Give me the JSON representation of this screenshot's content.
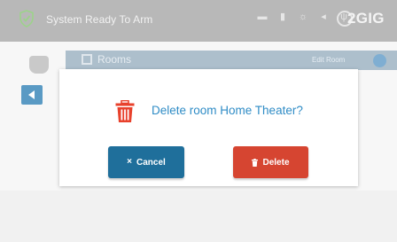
{
  "status_bar": {
    "status_text": "System Ready To Arm",
    "brand": "2GIG",
    "icons": [
      "message-icon",
      "bookmark-icon",
      "brightness-icon",
      "volume-icon",
      "wifi-icon"
    ]
  },
  "background_page": {
    "title": "Rooms",
    "right_label": "Edit Room"
  },
  "dialog": {
    "message": "Delete room Home Theater?",
    "cancel_label": "Cancel",
    "cancel_glyph": "×",
    "delete_label": "Delete",
    "colors": {
      "accent": "#2f8cc6",
      "cancel": "#1f6f9b",
      "delete": "#d64531",
      "trash_icon": "#e8412c"
    }
  }
}
